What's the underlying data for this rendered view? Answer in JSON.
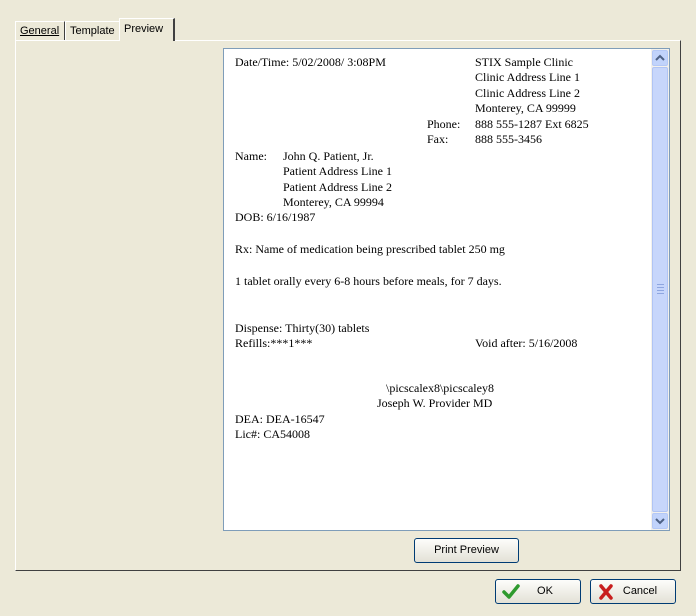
{
  "tabs": [
    {
      "label": "General"
    },
    {
      "label": "Template"
    },
    {
      "label": "Preview"
    }
  ],
  "preview": {
    "datetime": "Date/Time: 5/02/2008/ 3:08PM",
    "clinic_name": "STIX Sample Clinic",
    "clinic_addr1": "Clinic Address Line 1",
    "clinic_addr2": "Clinic Address Line 2",
    "clinic_city": "Monterey, CA 99999",
    "phone_label": "Phone:",
    "phone_value": "888 555-1287  Ext 6825",
    "fax_label": "Fax:",
    "fax_value": "888 555-3456",
    "name_label": "Name:",
    "patient_name": "John Q. Patient, Jr.",
    "patient_addr1": "Patient Address Line 1",
    "patient_addr2": "Patient Address Line 2",
    "patient_city": "Monterey, CA 99994",
    "dob": "DOB: 6/16/1987",
    "rx": "Rx: Name of medication being prescribed  tablet 250 mg",
    "sig": "1 tablet orally every 6-8 hours before meals, for 7 days.",
    "dispense": "Dispense: Thirty(30) tablets",
    "refills": "Refills:***1***",
    "void_after": "Void after:  5/16/2008",
    "pic_code": "\\picscalex8\\picscaley8",
    "provider": "Joseph W. Provider MD",
    "dea": "DEA: DEA-16547",
    "lic": "Lic#: CA54008"
  },
  "buttons": {
    "print_preview": "Print Preview",
    "ok": "OK",
    "cancel": "Cancel"
  },
  "colors": {
    "dialog_bg": "#ece9d8",
    "ok_check": "#2e9a2e",
    "cancel_x": "#c81e1e"
  }
}
